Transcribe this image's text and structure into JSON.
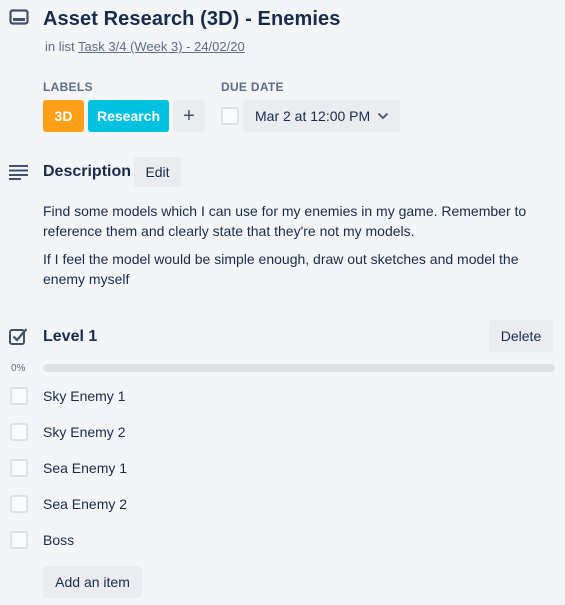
{
  "card": {
    "title": "Asset Research (3D) - Enemies",
    "in_list_prefix": "in list",
    "list_name": "Task 3/4 (Week 3) - 24/02/20"
  },
  "labels": {
    "heading": "LABELS",
    "items": [
      {
        "text": "3D",
        "color": "#ff9f1a"
      },
      {
        "text": "Research",
        "color": "#00c2e0"
      }
    ],
    "add_symbol": "+"
  },
  "due_date": {
    "heading": "DUE DATE",
    "value": "Mar 2 at 12:00 PM"
  },
  "description": {
    "heading": "Description",
    "edit_label": "Edit",
    "paragraphs": [
      "Find some models which I can use for my enemies in my game. Remember to reference them and clearly state that they're not my models.",
      "If I feel the model would be simple enough, draw out sketches and model the enemy myself"
    ]
  },
  "checklist": {
    "title": "Level 1",
    "delete_label": "Delete",
    "progress_text": "0%",
    "progress": 0,
    "items": [
      {
        "text": "Sky Enemy 1",
        "checked": false
      },
      {
        "text": "Sky Enemy 2",
        "checked": false
      },
      {
        "text": "Sea Enemy 1",
        "checked": false
      },
      {
        "text": "Sea Enemy 2",
        "checked": false
      },
      {
        "text": "Boss",
        "checked": false
      }
    ],
    "add_item_label": "Add an item"
  },
  "icons": {
    "card": "card-icon",
    "description": "description-lines-icon",
    "checklist": "checklist-icon",
    "dropdown": "chevron-down-icon"
  },
  "colors": {
    "background": "#f4f5f7",
    "text": "#172b4d",
    "muted": "#5e6c84",
    "button_bg": "#ebecf0"
  }
}
